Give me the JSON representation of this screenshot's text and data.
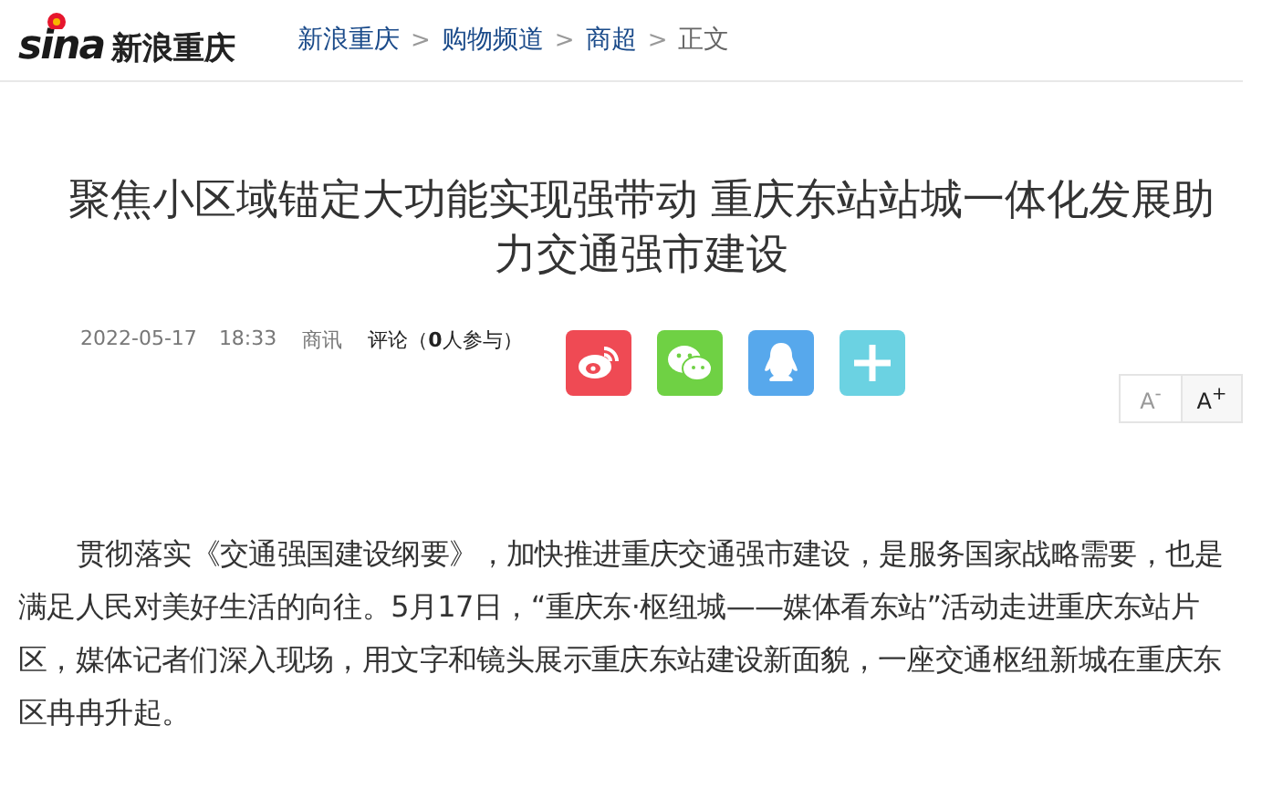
{
  "header": {
    "logo_text": "sina",
    "site_name": "新浪重庆",
    "breadcrumbs": [
      {
        "label": "新浪重庆",
        "current": false
      },
      {
        "label": "购物频道",
        "current": false
      },
      {
        "label": "商超",
        "current": false
      },
      {
        "label": "正文",
        "current": true
      }
    ],
    "separator": ">"
  },
  "article": {
    "title": "聚焦小区域锚定大功能实现强带动 重庆东站站城一体化发展助力交通强市建设",
    "date": "2022-05-17",
    "time": "18:33",
    "source": "商讯",
    "comments": "评论（**0**人参与）",
    "share": [
      {
        "kind": "weibo",
        "color": "#ef4a54"
      },
      {
        "kind": "wechat",
        "color": "#6fd144"
      },
      {
        "kind": "qq",
        "color": "#57a8ec"
      },
      {
        "kind": "more",
        "color": "#6bd2e2"
      }
    ],
    "font_buttons": [
      {
        "letter": "A",
        "sign": "-",
        "selected": false
      },
      {
        "letter": "A",
        "sign": "+",
        "selected": true
      }
    ],
    "paragraphs": [
      "贯彻落实《交通强国建设纲要》，加快推进重庆交通强市建设，是服务国家战略需要，也是满足人民对美好生活的向往。5月17日，“重庆东·枢纽城——媒体看东站”活动走进重庆东站片区，媒体记者们深入现场，用文字和镜头展示重庆东站建设新面貌，一座交通枢纽新城在重庆东区冉冉升起。"
    ]
  }
}
